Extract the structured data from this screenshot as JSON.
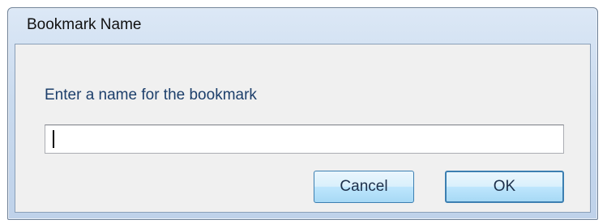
{
  "dialog": {
    "title": "Bookmark Name",
    "prompt": "Enter a name for the bookmark",
    "name_value": "",
    "buttons": {
      "cancel_label": "Cancel",
      "ok_label": "OK"
    }
  },
  "colors": {
    "title_bar": "#c9daee",
    "client_bg": "#f0f0f0",
    "prompt_text": "#1d3f6b",
    "button_border": "#3c7fb1"
  }
}
